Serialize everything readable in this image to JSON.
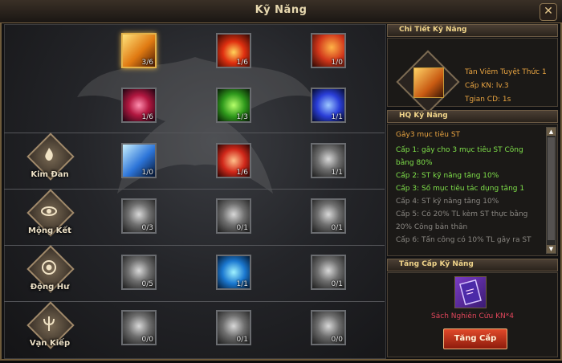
{
  "window": {
    "title": "Kỹ Năng",
    "close_glyph": "✕"
  },
  "branches": [
    {
      "name": "Kim Đan"
    },
    {
      "name": "Mộng Kết"
    },
    {
      "name": "Động Hư"
    },
    {
      "name": "Vạn Kiếp"
    }
  ],
  "skills": [
    {
      "level": "3/6",
      "icon": "flame-slash-icon",
      "selected": true
    },
    {
      "level": "1/6",
      "icon": "fire-burst-icon"
    },
    {
      "level": "1/0",
      "icon": "fire-strike-icon"
    },
    {
      "level": "1/6",
      "icon": "vortex-icon"
    },
    {
      "level": "1/3",
      "icon": "poison-dragon-icon"
    },
    {
      "level": "1/1",
      "icon": "arcane-orb-icon"
    },
    {
      "level": "1/0",
      "icon": "ice-blade-icon"
    },
    {
      "level": "1/6",
      "icon": "fire-claw-icon"
    },
    {
      "level": "1/1",
      "icon": "slash-gray-icon"
    },
    {
      "level": "0/3",
      "icon": "storm-gray-icon"
    },
    {
      "level": "0/1",
      "icon": "shatter-gray-icon"
    },
    {
      "level": "0/1",
      "icon": "burst-gray-icon"
    },
    {
      "level": "0/5",
      "icon": "wave-gray-icon"
    },
    {
      "level": "1/1",
      "icon": "water-vortex-icon"
    },
    {
      "level": "0/1",
      "icon": "spiral-gray-icon"
    },
    {
      "level": "0/0",
      "icon": "sword-gray-icon"
    },
    {
      "level": "0/1",
      "icon": "crescent-gray-icon"
    },
    {
      "level": "0/0",
      "icon": "demon-gray-icon"
    }
  ],
  "detail": {
    "header": "Chi Tiết Kỹ Năng",
    "name": "Tàn Viêm Tuyệt Thức 1",
    "level": "Cấp KN: lv.3",
    "cooldown": "Tgian CD: 1s"
  },
  "effects": {
    "header": "HQ Kỹ Năng",
    "intro": "Gây3 mục tiêu ST",
    "lines": [
      {
        "text": "Cấp 1:  gây cho 3 mục tiêu ST Công",
        "color": "#7fe04a"
      },
      {
        "text": "            bằng 80%",
        "color": "#7fe04a"
      },
      {
        "text": "Cấp 2:  ST kỹ năng tăng 10%",
        "color": "#7fe04a"
      },
      {
        "text": "Cấp 3:  Số mục tiêu tác dụng tăng 1",
        "color": "#7fe04a"
      },
      {
        "text": "Cấp 4:  ST kỹ năng tăng 10%",
        "color": "#8a8782"
      },
      {
        "text": "Cấp 5:  Có 20% TL kèm ST thực bằng",
        "color": "#8a8782"
      },
      {
        "text": "            20% Công bản thân",
        "color": "#8a8782"
      },
      {
        "text": "Cấp 6:  Tấn công có 10% TL gây ra ST",
        "color": "#8a8782"
      }
    ]
  },
  "upgrade": {
    "header": "Tăng Cấp Kỹ Năng",
    "item_label": "Sách Nghiên Cứu KN*4",
    "button": "Tăng Cấp"
  },
  "colors": {
    "accent": "#e3b24a",
    "button": "#c8331b",
    "active_text": "#7fe04a"
  }
}
